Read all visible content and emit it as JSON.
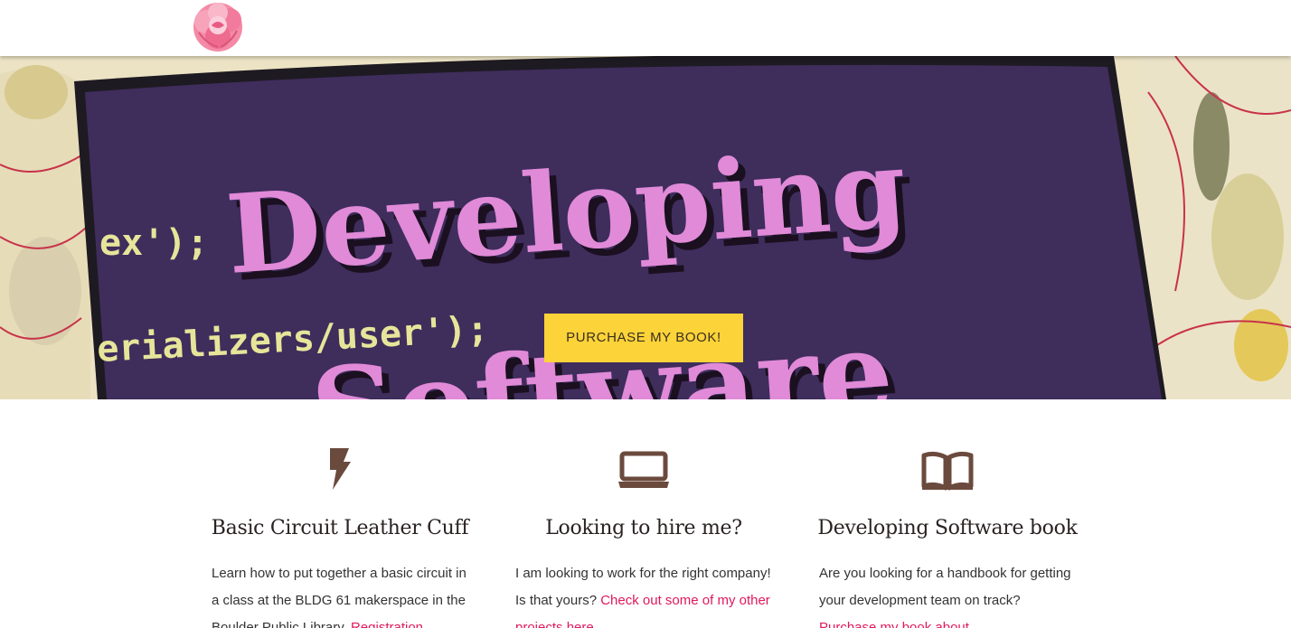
{
  "nav": {
    "logo_icon": "peony-flower-logo"
  },
  "hero": {
    "book_title_line1": "Developing",
    "book_title_line2": "Software",
    "code_line1": "ex');",
    "code_line2": "erializers/user');",
    "cta_label": "PURCHASE MY BOOK!",
    "colors": {
      "cta_bg": "#fcd338",
      "book_cover": "#3f2d5c",
      "book_title": "#e08ad8",
      "code_text": "#e6e59a"
    }
  },
  "features": [
    {
      "icon": "lightning-bolt-icon",
      "title": "Basic Circuit Leather Cuff",
      "text": "Learn how to put together a basic circuit in a class at the BLDG 61 makerspace in the Boulder Public Library.",
      "link": "Registration"
    },
    {
      "icon": "laptop-icon",
      "title": "Looking to hire me?",
      "text": "I am looking to work for the right company! Is that yours?",
      "link": "Check out some of my other projects here"
    },
    {
      "icon": "open-book-icon",
      "title": "Developing Software book",
      "text": "Are you looking for a handbook for getting your development team on track?",
      "link": "Purchase my book about"
    }
  ],
  "colors": {
    "icon": "#6b4a3e",
    "link": "#e0185f"
  }
}
